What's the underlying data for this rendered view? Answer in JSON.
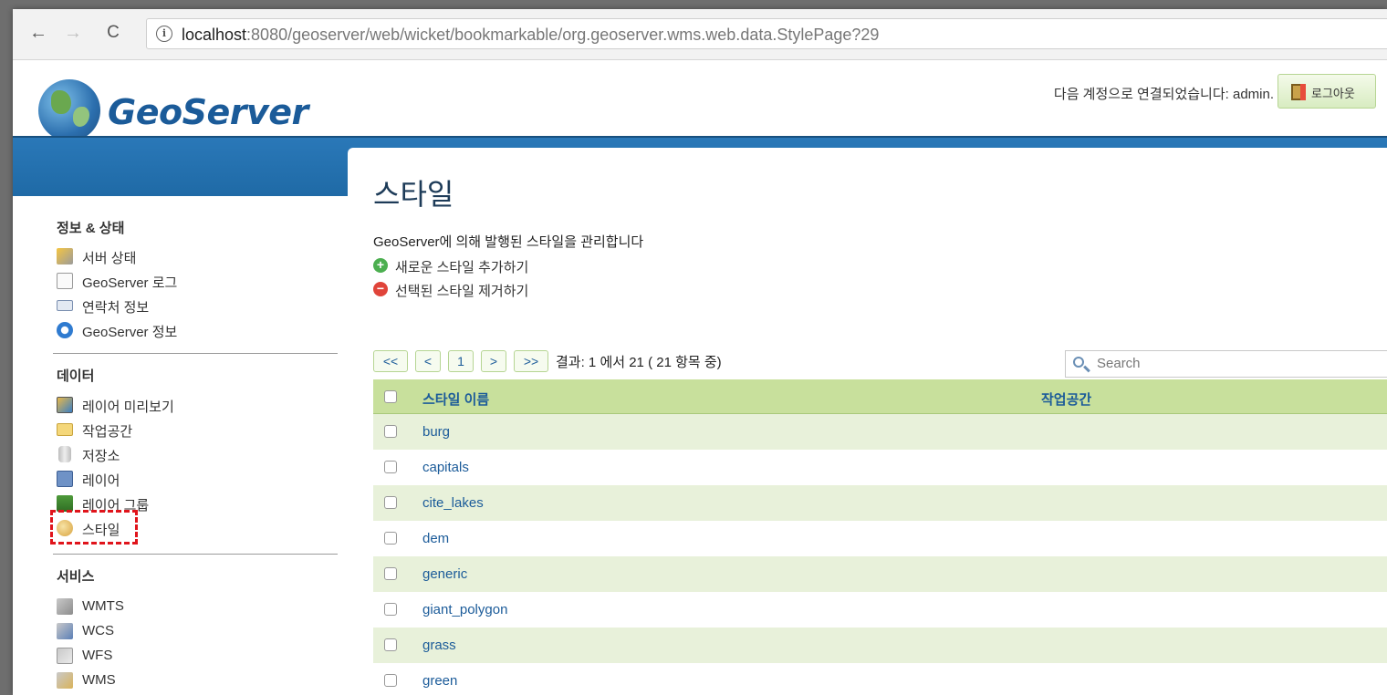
{
  "browser": {
    "back": "←",
    "forward": "→",
    "reload": "C",
    "info": "i",
    "url_host": "localhost",
    "url_rest": ":8080/geoserver/web/wicket/bookmarkable/org.geoserver.wms.web.data.StylePage?29"
  },
  "header": {
    "logo_text": "GeoServer",
    "login_message": "다음 계정으로 연결되었습니다: admin.",
    "logout_label": "로그아웃"
  },
  "sidebar": {
    "sections": [
      {
        "title": "정보 & 상태",
        "items": [
          {
            "label": "서버 상태",
            "icon": "server-status-icon"
          },
          {
            "label": "GeoServer 로그",
            "icon": "log-icon"
          },
          {
            "label": "연락처 정보",
            "icon": "contact-icon"
          },
          {
            "label": "GeoServer 정보",
            "icon": "info-icon"
          }
        ]
      },
      {
        "title": "데이터",
        "items": [
          {
            "label": "레이어 미리보기",
            "icon": "layer-preview-icon"
          },
          {
            "label": "작업공간",
            "icon": "workspace-folder-icon"
          },
          {
            "label": "저장소",
            "icon": "store-icon"
          },
          {
            "label": "레이어",
            "icon": "layer-icon"
          },
          {
            "label": "레이어 그룹",
            "icon": "layer-group-icon"
          },
          {
            "label": "스타일",
            "icon": "style-palette-icon"
          }
        ]
      },
      {
        "title": "서비스",
        "items": [
          {
            "label": "WMTS",
            "icon": "wmts-icon"
          },
          {
            "label": "WCS",
            "icon": "wcs-icon"
          },
          {
            "label": "WFS",
            "icon": "wfs-icon"
          },
          {
            "label": "WMS",
            "icon": "wms-icon"
          }
        ]
      }
    ]
  },
  "main": {
    "title": "스타일",
    "description": "GeoServer에 의해 발행된 스타일을 관리합니다",
    "add_label": "새로운 스타일 추가하기",
    "remove_label": "선택된 스타일 제거하기",
    "pager": {
      "first": "<<",
      "prev": "<",
      "page": "1",
      "next": ">",
      "last": ">>",
      "result": "결과: 1 에서 21 ( 21 항목 중)"
    },
    "search_placeholder": "Search",
    "table": {
      "columns": [
        "스타일 이름",
        "작업공간"
      ],
      "rows": [
        "burg",
        "capitals",
        "cite_lakes",
        "dem",
        "generic",
        "giant_polygon",
        "grass",
        "green"
      ]
    }
  },
  "colors": {
    "brand_blue": "#1b5b99",
    "band_blue": "#2a78b8",
    "header_green": "#c8e09c",
    "row_green": "#e8f1da",
    "highlight_red": "#e0141b"
  }
}
